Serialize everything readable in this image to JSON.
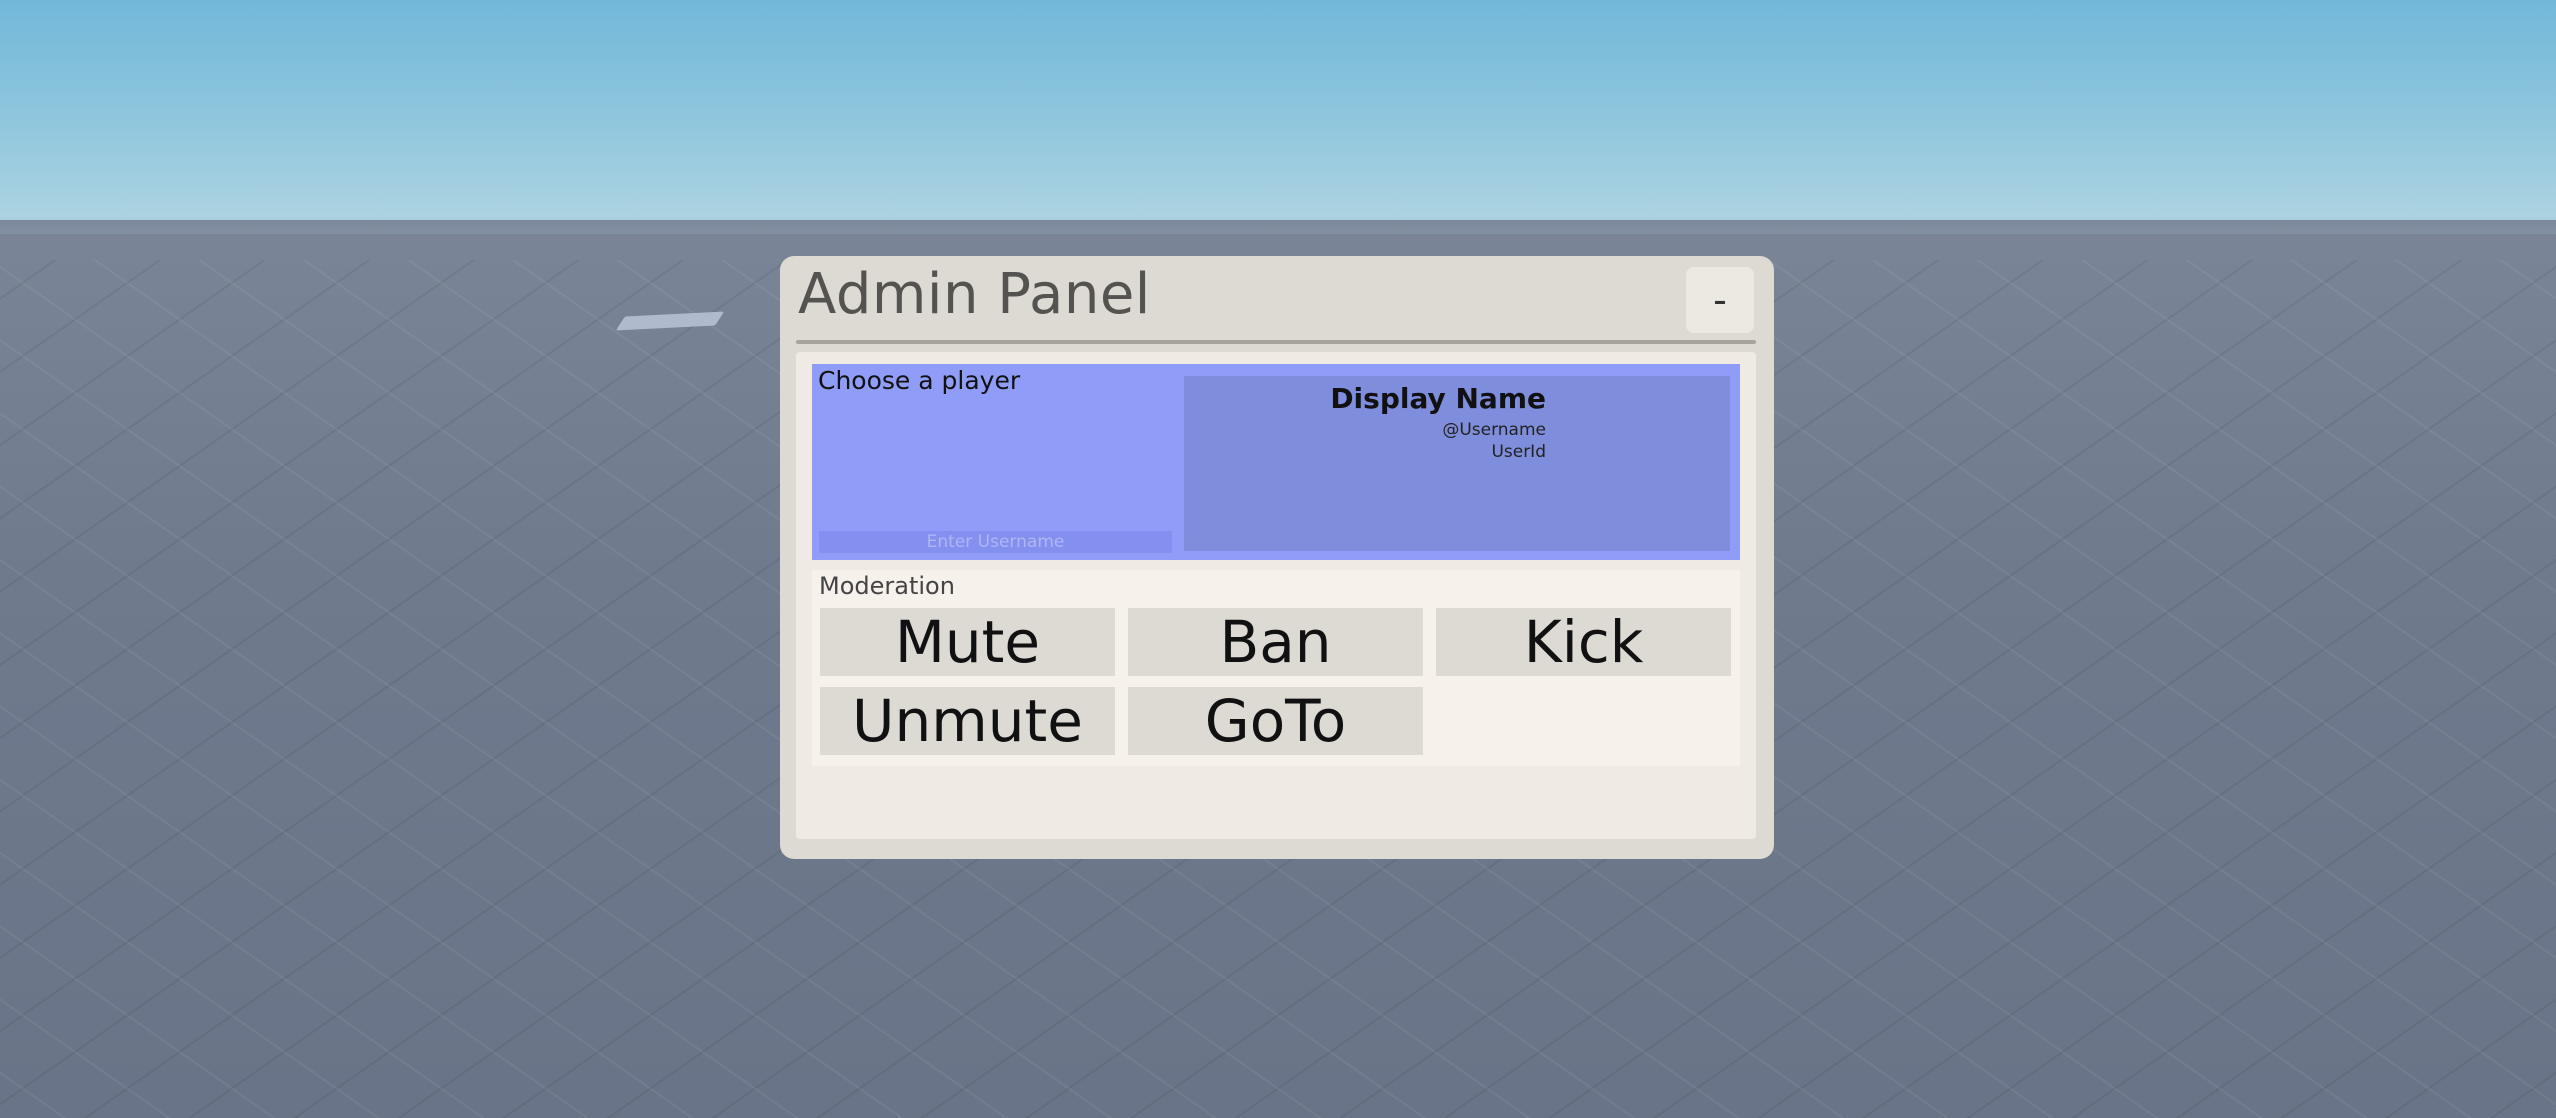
{
  "panel": {
    "title": "Admin Panel",
    "minimize_label": "-"
  },
  "player_select": {
    "label": "Choose a player",
    "input_placeholder": "Enter Username",
    "input_value": ""
  },
  "player_info": {
    "display_name": "Display Name",
    "username": "@Username",
    "user_id": "UserId"
  },
  "moderation": {
    "label": "Moderation",
    "buttons": {
      "mute": "Mute",
      "ban": "Ban",
      "kick": "Kick",
      "unmute": "Unmute",
      "goto": "GoTo"
    }
  },
  "colors": {
    "panel_bg": "#ddd9d3",
    "player_section_bg": "#8f9cf8",
    "player_info_bg": "#7f8ddd",
    "moderation_bg": "#f7f1ec",
    "button_bg": "#ddd9d3"
  }
}
